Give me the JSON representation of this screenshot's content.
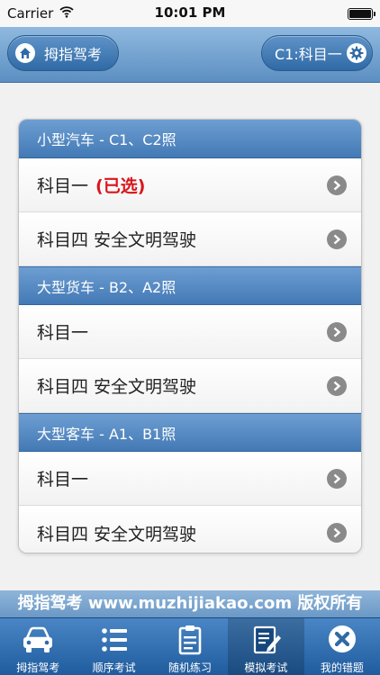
{
  "status_bar": {
    "carrier": "Carrier",
    "time": "10:01 PM"
  },
  "header": {
    "home_label": "拇指驾考",
    "setting_label": "C1:科目一"
  },
  "groups": [
    {
      "title": "小型汽车 - C1、C2照",
      "items": [
        {
          "label": "科目一",
          "selected_tag": "(已选)"
        },
        {
          "label": "科目四 安全文明驾驶"
        }
      ]
    },
    {
      "title": "大型货车 - B2、A2照",
      "items": [
        {
          "label": "科目一"
        },
        {
          "label": "科目四 安全文明驾驶"
        }
      ]
    },
    {
      "title": "大型客车 - A1、B1照",
      "items": [
        {
          "label": "科目一"
        },
        {
          "label": "科目四 安全文明驾驶"
        }
      ]
    }
  ],
  "copyright": "拇指驾考 www.muzhijiakao.com 版权所有",
  "tabbar": {
    "active_tab": "模拟考试",
    "tabs": [
      {
        "label": "拇指驾考",
        "icon": "car-icon"
      },
      {
        "label": "顺序考试",
        "icon": "list-icon"
      },
      {
        "label": "随机练习",
        "icon": "clipboard-icon"
      },
      {
        "label": "模拟考试",
        "icon": "edit-document-icon"
      },
      {
        "label": "我的错题",
        "icon": "close-circle-icon"
      }
    ]
  },
  "colors": {
    "header": "#5c8fc2",
    "group_header": "#4379b5",
    "selected_tag": "#d8161c",
    "tabbar": "#1f5c9e"
  }
}
